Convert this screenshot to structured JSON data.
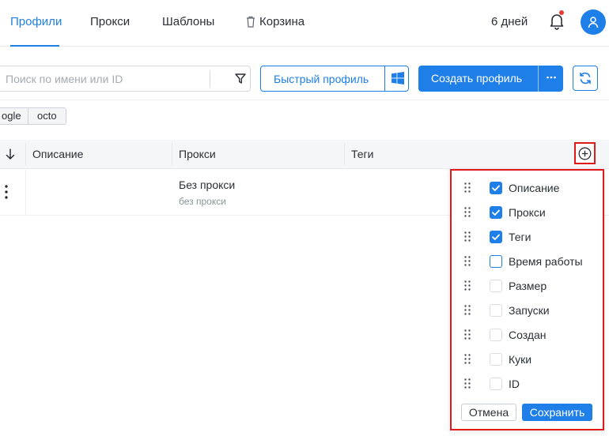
{
  "nav": {
    "tabs": [
      {
        "label": "Профили",
        "active": true
      },
      {
        "label": "Прокси",
        "active": false
      },
      {
        "label": "Шаблоны",
        "active": false
      },
      {
        "label": "Корзина",
        "active": false,
        "icon": "trash-icon"
      }
    ],
    "days_left": "6 дней",
    "notification_icon": "bell-icon",
    "has_unread": true,
    "avatar_icon": "user-icon"
  },
  "toolbar": {
    "search_placeholder": "Поиск по имени или ID",
    "filter_icon": "filter-icon",
    "quick_profile_label": "Быстрый профиль",
    "os_icon": "windows-icon",
    "create_profile_label": "Создать профиль",
    "more_icon": "more-icon",
    "refresh_icon": "refresh-icon"
  },
  "tag_chips": [
    "ogle",
    "octo"
  ],
  "table": {
    "columns": [
      "Описание",
      "Прокси",
      "Теги"
    ],
    "add_column_icon": "plus-circle-icon",
    "rows": [
      {
        "description": "",
        "proxy": "Без прокси",
        "proxy_sub": "без прокси",
        "tags": ""
      }
    ]
  },
  "column_settings": {
    "options": [
      {
        "label": "Описание",
        "checked": true
      },
      {
        "label": "Прокси",
        "checked": true
      },
      {
        "label": "Теги",
        "checked": true
      },
      {
        "label": "Время работы",
        "checked": false
      },
      {
        "label": "Размер",
        "checked": false
      },
      {
        "label": "Запуски",
        "checked": false
      },
      {
        "label": "Создан",
        "checked": false
      },
      {
        "label": "Куки",
        "checked": false
      },
      {
        "label": "ID",
        "checked": false
      }
    ],
    "cancel_label": "Отмена",
    "save_label": "Сохранить"
  },
  "colors": {
    "accent": "#1f7fe8",
    "highlight_border": "#e01818",
    "badge_dot": "#e53935"
  }
}
